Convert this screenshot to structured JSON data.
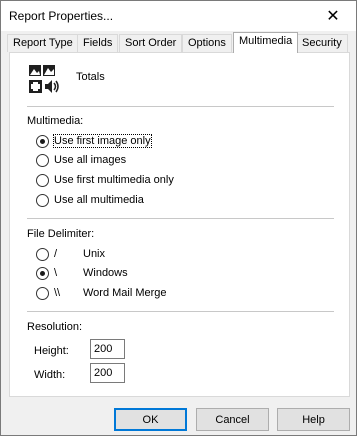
{
  "window": {
    "title": "Report Properties...",
    "close_glyph": "✕"
  },
  "tabs": [
    {
      "label": "Report Type",
      "active": false
    },
    {
      "label": "Fields",
      "active": false
    },
    {
      "label": "Sort Order",
      "active": false
    },
    {
      "label": "Options",
      "active": false
    },
    {
      "label": "Multimedia",
      "active": true
    },
    {
      "label": "Security",
      "active": false
    }
  ],
  "header": {
    "icon": "multimedia-icon",
    "label": "Totals"
  },
  "multimedia": {
    "group_label": "Multimedia:",
    "options": [
      {
        "label": "Use first image only",
        "checked": true
      },
      {
        "label": "Use all images",
        "checked": false
      },
      {
        "label": "Use first multimedia only",
        "checked": false
      },
      {
        "label": "Use all multimedia",
        "checked": false
      }
    ]
  },
  "delimiter": {
    "group_label": "File Delimiter:",
    "options": [
      {
        "symbol": "/",
        "label": "Unix",
        "checked": false
      },
      {
        "symbol": "\\",
        "label": "Windows",
        "checked": true
      },
      {
        "symbol": "\\\\",
        "label": "Word Mail Merge",
        "checked": false
      }
    ]
  },
  "resolution": {
    "group_label": "Resolution:",
    "height_label": "Height:",
    "height_value": "200",
    "width_label": "Width:",
    "width_value": "200"
  },
  "buttons": {
    "ok": "OK",
    "cancel": "Cancel",
    "help": "Help"
  },
  "colors": {
    "focus_border": "#0078d7",
    "panel_bg": "#ffffff",
    "dialog_bg": "#f0f0f0"
  }
}
